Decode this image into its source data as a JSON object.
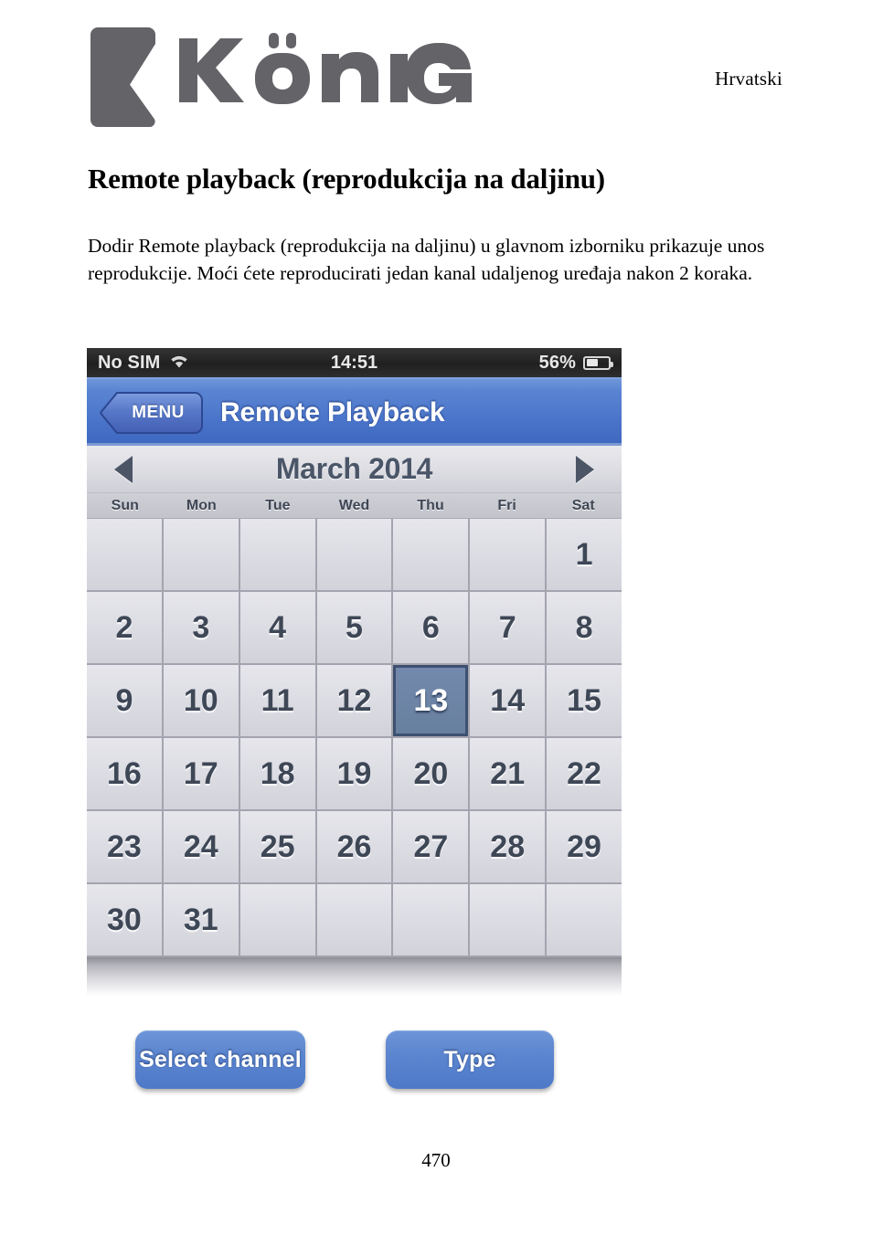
{
  "header": {
    "brand_name": "KÖNIG",
    "language": "Hrvatski",
    "logo_color": "#636368"
  },
  "document": {
    "heading": "Remote playback (reprodukcija na daljinu)",
    "paragraph": "Dodir Remote playback (reprodukcija na daljinu) u glavnom izborniku prikazuje unos reprodukcije. Moći ćete reproducirati jedan kanal udaljenog uređaja nakon 2 koraka.",
    "page_number": "470"
  },
  "phone": {
    "statusbar": {
      "carrier": "No SIM",
      "time": "14:51",
      "battery_percent": "56%",
      "battery_level": 56,
      "wifi_icon": "wifi-icon",
      "battery_icon": "battery-icon",
      "background_color": "#2a2a2a"
    },
    "navbar": {
      "back_label": "MENU",
      "title": "Remote Playback",
      "accent_color": "#4a74c9"
    },
    "calendar": {
      "prev_icon": "triangle-left-icon",
      "next_icon": "triangle-right-icon",
      "month_label": "March 2014",
      "weekdays": [
        "Sun",
        "Mon",
        "Tue",
        "Wed",
        "Thu",
        "Fri",
        "Sat"
      ],
      "selected_day": 13,
      "selected_color": "#68809f",
      "weeks": [
        [
          "",
          "",
          "",
          "",
          "",
          "",
          "1"
        ],
        [
          "2",
          "3",
          "4",
          "5",
          "6",
          "7",
          "8"
        ],
        [
          "9",
          "10",
          "11",
          "12",
          "13",
          "14",
          "15"
        ],
        [
          "16",
          "17",
          "18",
          "19",
          "20",
          "21",
          "22"
        ],
        [
          "23",
          "24",
          "25",
          "26",
          "27",
          "28",
          "29"
        ],
        [
          "30",
          "31",
          "",
          "",
          "",
          "",
          ""
        ]
      ]
    }
  },
  "buttons": {
    "select_channel": "Select channel",
    "type": "Type",
    "color": "#5c86cf"
  }
}
